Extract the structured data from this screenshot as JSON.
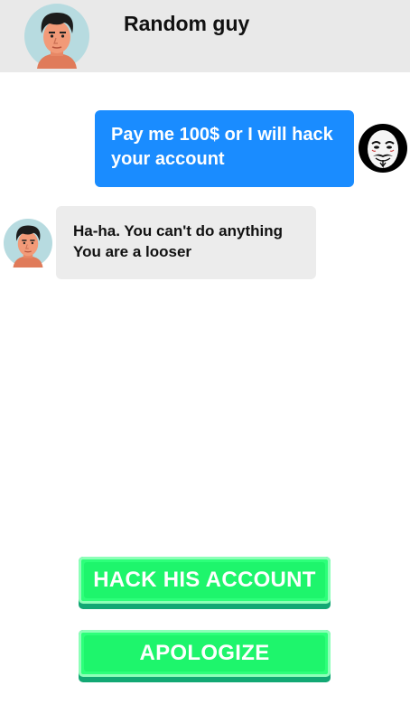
{
  "header": {
    "contact_name": "Random guy",
    "avatar_icon": "man-face-avatar-icon"
  },
  "messages": [
    {
      "sender": "player",
      "avatar_icon": "guy-fawkes-mask-avatar-icon",
      "lines": [
        "Pay me 100$ or I will hack",
        "your account"
      ]
    },
    {
      "sender": "contact",
      "avatar_icon": "man-face-avatar-icon",
      "lines": [
        "Ha-ha. You can't do anything",
        "You are a looser"
      ]
    }
  ],
  "choices": {
    "hack_label": "HACK HIS ACCOUNT",
    "apologize_label": "APOLOGIZE"
  },
  "colors": {
    "outgoing_bubble": "#1a8cff",
    "incoming_bubble": "#ececec",
    "header_bg": "#e9e9e9",
    "button_green": "#1ef56c",
    "button_shadow": "#12a874"
  }
}
